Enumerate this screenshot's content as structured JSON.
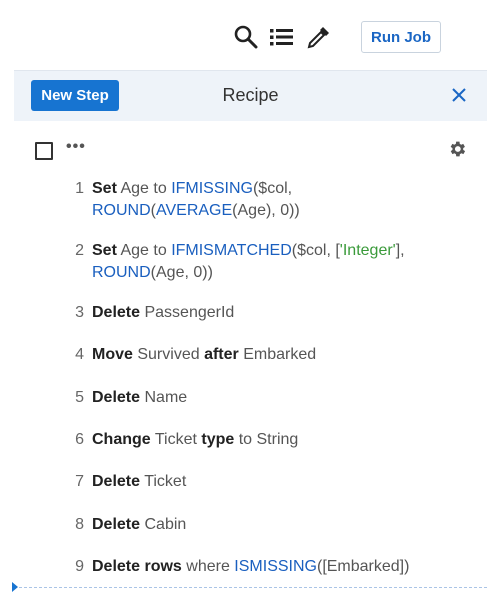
{
  "toolbar": {
    "run_job_label": "Run Job",
    "icons": [
      "search-icon",
      "list-icon",
      "eyedropper-icon"
    ]
  },
  "recipe": {
    "new_step_label": "New Step",
    "title": "Recipe"
  },
  "steps": [
    {
      "num": "1",
      "line1": [
        [
          "kw",
          "Set"
        ],
        [
          "",
          "Age"
        ],
        [
          "",
          "to"
        ],
        [
          "fn",
          "IFMISSING"
        ],
        [
          "",
          "($col,"
        ]
      ],
      "line2": [
        [
          "fn",
          "ROUND"
        ],
        [
          "",
          "("
        ],
        [
          "fn",
          "AVERAGE"
        ],
        [
          "",
          "(Age), 0))"
        ]
      ]
    },
    {
      "num": "2",
      "line1": [
        [
          "kw",
          "Set"
        ],
        [
          "",
          "Age"
        ],
        [
          "",
          "to"
        ],
        [
          "fn",
          "IFMISMATCHED"
        ],
        [
          "",
          "($col, ["
        ],
        [
          "str",
          "'Integer'"
        ],
        [
          "",
          "],"
        ]
      ],
      "line2": [
        [
          "fn",
          "ROUND"
        ],
        [
          "",
          "(Age, 0))"
        ]
      ]
    },
    {
      "num": "3",
      "line1": [
        [
          "kw",
          "Delete"
        ],
        [
          "",
          "PassengerId"
        ]
      ]
    },
    {
      "num": "4",
      "line1": [
        [
          "kw",
          "Move"
        ],
        [
          "",
          "Survived"
        ],
        [
          "kw",
          "after"
        ],
        [
          "",
          "Embarked"
        ]
      ]
    },
    {
      "num": "5",
      "line1": [
        [
          "kw",
          "Delete"
        ],
        [
          "",
          "Name"
        ]
      ]
    },
    {
      "num": "6",
      "line1": [
        [
          "kw",
          "Change"
        ],
        [
          "",
          "Ticket"
        ],
        [
          "kw",
          "type"
        ],
        [
          "",
          "to String"
        ]
      ]
    },
    {
      "num": "7",
      "line1": [
        [
          "kw",
          "Delete"
        ],
        [
          "",
          "Ticket"
        ]
      ]
    },
    {
      "num": "8",
      "line1": [
        [
          "kw",
          "Delete"
        ],
        [
          "",
          "Cabin"
        ]
      ]
    },
    {
      "num": "9",
      "line1": [
        [
          "kw",
          "Delete rows"
        ],
        [
          "",
          "where"
        ],
        [
          "fn",
          "ISMISSING"
        ],
        [
          "",
          "([Embarked])"
        ]
      ]
    }
  ],
  "colors": {
    "accent": "#1774d1",
    "function": "#1a5fbf",
    "string": "#3a9a3a",
    "header_bg": "#eef3f9"
  }
}
